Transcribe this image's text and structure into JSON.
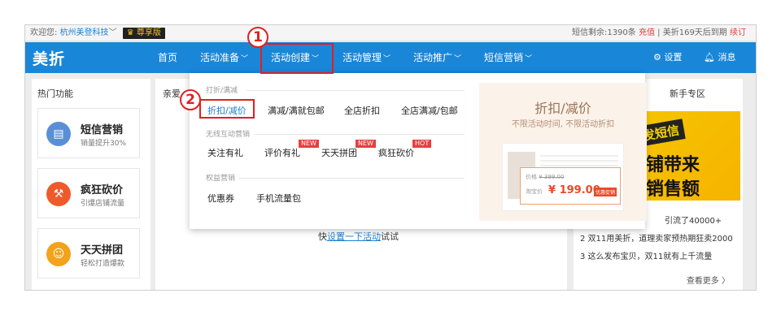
{
  "topbar": {
    "welcome": "欢迎您:",
    "org": "杭州美登科技",
    "vip": "尊享版",
    "sms_left_label": "短信剩余:",
    "sms_count": "1390条",
    "recharge": "充值",
    "expire_text": "美折169天后到期",
    "renew": "续订"
  },
  "nav": {
    "logo": "美折",
    "items": [
      "首页",
      "活动准备",
      "活动创建",
      "活动管理",
      "活动推广",
      "短信营销"
    ],
    "settings": "设置",
    "messages": "消息"
  },
  "callouts": {
    "one": "1",
    "two": "2"
  },
  "hot": {
    "title": "热门功能",
    "cards": [
      {
        "title": "短信营销",
        "sub": "销量提升30%"
      },
      {
        "title": "疯狂砍价",
        "sub": "引爆店铺流量"
      },
      {
        "title": "天天拼团",
        "sub": "轻松打造爆款"
      }
    ]
  },
  "middle": {
    "greeting": "亲爱",
    "tip_pre": "快",
    "tip_link": "设置一下活动",
    "tip_post": "试试"
  },
  "newbie": {
    "title": "新手专区",
    "banner_line1": "发短信",
    "banner_line2": "铺带来",
    "banner_line3": "销售额",
    "news": [
      "引流了40000+",
      "2  双11用美折，道理卖家预热期狂卖2000",
      "3  这么发布宝贝，双11就有上千流量"
    ],
    "more": "查看更多 〉"
  },
  "dropdown": {
    "groups": [
      {
        "label": "打折/满减",
        "items": [
          "折扣/减价",
          "满减/满就包邮",
          "全店折扣",
          "全店满减/包邮"
        ]
      },
      {
        "label": "无线互动营销",
        "items": [
          "关注有礼",
          "评价有礼",
          "天天拼团",
          "疯狂砍价"
        ]
      },
      {
        "label": "权益营销",
        "items": [
          "优惠券",
          "手机流量包"
        ]
      }
    ],
    "tags": {
      "new1": "NEW",
      "new2": "NEW",
      "hot": "HOT"
    },
    "promo": {
      "title": "折扣/减价",
      "subtitle": "不限活动时间, 不限活动折扣",
      "price_label": "价格",
      "orig_price": "¥ 399.00",
      "sale_label": "淘宝价",
      "sale_price": "¥ 199.00",
      "sale_btn": "优惠促销"
    }
  }
}
